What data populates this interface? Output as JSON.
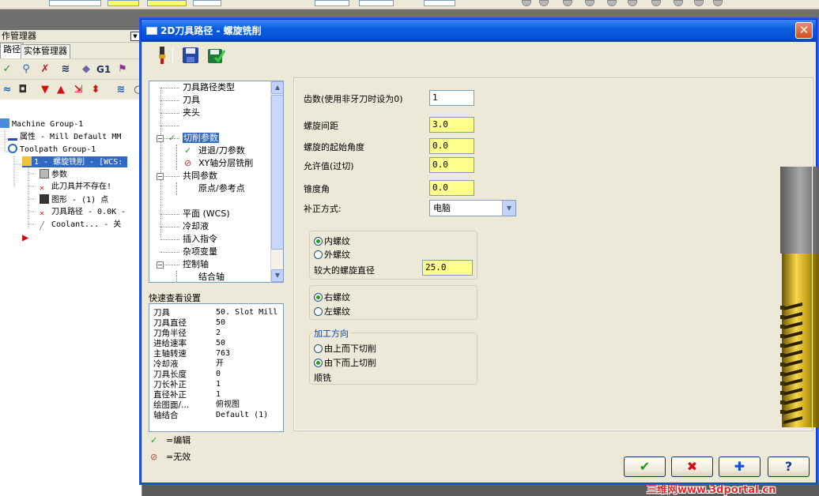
{
  "background_app": {
    "manager": {
      "title": "作管理器",
      "tabs": [
        "路径",
        "实体管理器"
      ],
      "tree": [
        {
          "label": "Machine Group-1"
        },
        {
          "label": "属性 - Mill Default MM"
        },
        {
          "label": "Toolpath Group-1"
        },
        {
          "label": "1 - 螺旋铣削 - [WCS:"
        },
        {
          "label": "参数"
        },
        {
          "label": "此刀具并不存在!"
        },
        {
          "label": "图形 - (1) 点"
        },
        {
          "label": "刀具路径 - 0.0K -"
        },
        {
          "label": "Coolant... - 关"
        }
      ]
    },
    "watermark": "三维网www.3dportal.cn"
  },
  "dialog": {
    "title": "2D刀具路径 - 螺旋铣削",
    "close_symbol": "✕",
    "tree": {
      "items": [
        {
          "label": "刀具路径类型"
        },
        {
          "label": "刀具"
        },
        {
          "label": "夹头"
        },
        {
          "label": "切削参数"
        },
        {
          "label": "进退/刀参数"
        },
        {
          "label": "XY轴分层铣削"
        },
        {
          "label": "共同参数"
        },
        {
          "label": "原点/参考点"
        },
        {
          "label": "平面 (WCS)"
        },
        {
          "label": "冷却液"
        },
        {
          "label": "插入指令"
        },
        {
          "label": "杂项变量"
        },
        {
          "label": "控制轴"
        },
        {
          "label": "结合轴"
        }
      ]
    },
    "quick_view": {
      "label": "快速查看设置",
      "rows": [
        {
          "k": "刀具",
          "v": "50. Slot Mill"
        },
        {
          "k": "刀具直径",
          "v": "50"
        },
        {
          "k": "刀角半径",
          "v": "2"
        },
        {
          "k": "进给速率",
          "v": "50"
        },
        {
          "k": "主轴转速",
          "v": "763"
        },
        {
          "k": "冷却液",
          "v": "开"
        },
        {
          "k": "刀具长度",
          "v": "0"
        },
        {
          "k": "刀长补正",
          "v": "1"
        },
        {
          "k": "直径补正",
          "v": "1"
        },
        {
          "k": "绘图面/...",
          "v": "俯视图"
        },
        {
          "k": "轴结合",
          "v": "Default (1)"
        }
      ]
    },
    "legend": {
      "edit_symbol": "✓",
      "edit_label": "=编辑",
      "invalid_symbol": "⊘",
      "invalid_label": "=无效"
    },
    "params": {
      "teeth_label": "齿数(使用非牙刀时设为0)",
      "teeth_value": "1",
      "pitch_label": "螺旋间距",
      "pitch_value": "3.0",
      "start_angle_label": "螺旋的起始角度",
      "start_angle_value": "0.0",
      "allowance_label": "允许值(过切)",
      "allowance_value": "0.0",
      "taper_label": "锥度角",
      "taper_value": "0.0",
      "comp_label": "补正方式:",
      "comp_value": "电脑",
      "thread_type": {
        "options": [
          "内螺纹",
          "外螺纹"
        ],
        "selected": "内螺纹",
        "major_dia_label": "较大的螺旋直径",
        "major_dia_value": "25.0"
      },
      "hand": {
        "options": [
          "右螺纹",
          "左螺纹"
        ],
        "selected": "右螺纹"
      },
      "direction": {
        "title": "加工方向",
        "options": [
          "由上而下切削",
          "由下而上切削"
        ],
        "selected": "由下而上切削",
        "note": "顺铣"
      }
    },
    "buttons": {
      "ok": "✔",
      "cancel": "✖",
      "add": "✚",
      "help": "?"
    }
  }
}
